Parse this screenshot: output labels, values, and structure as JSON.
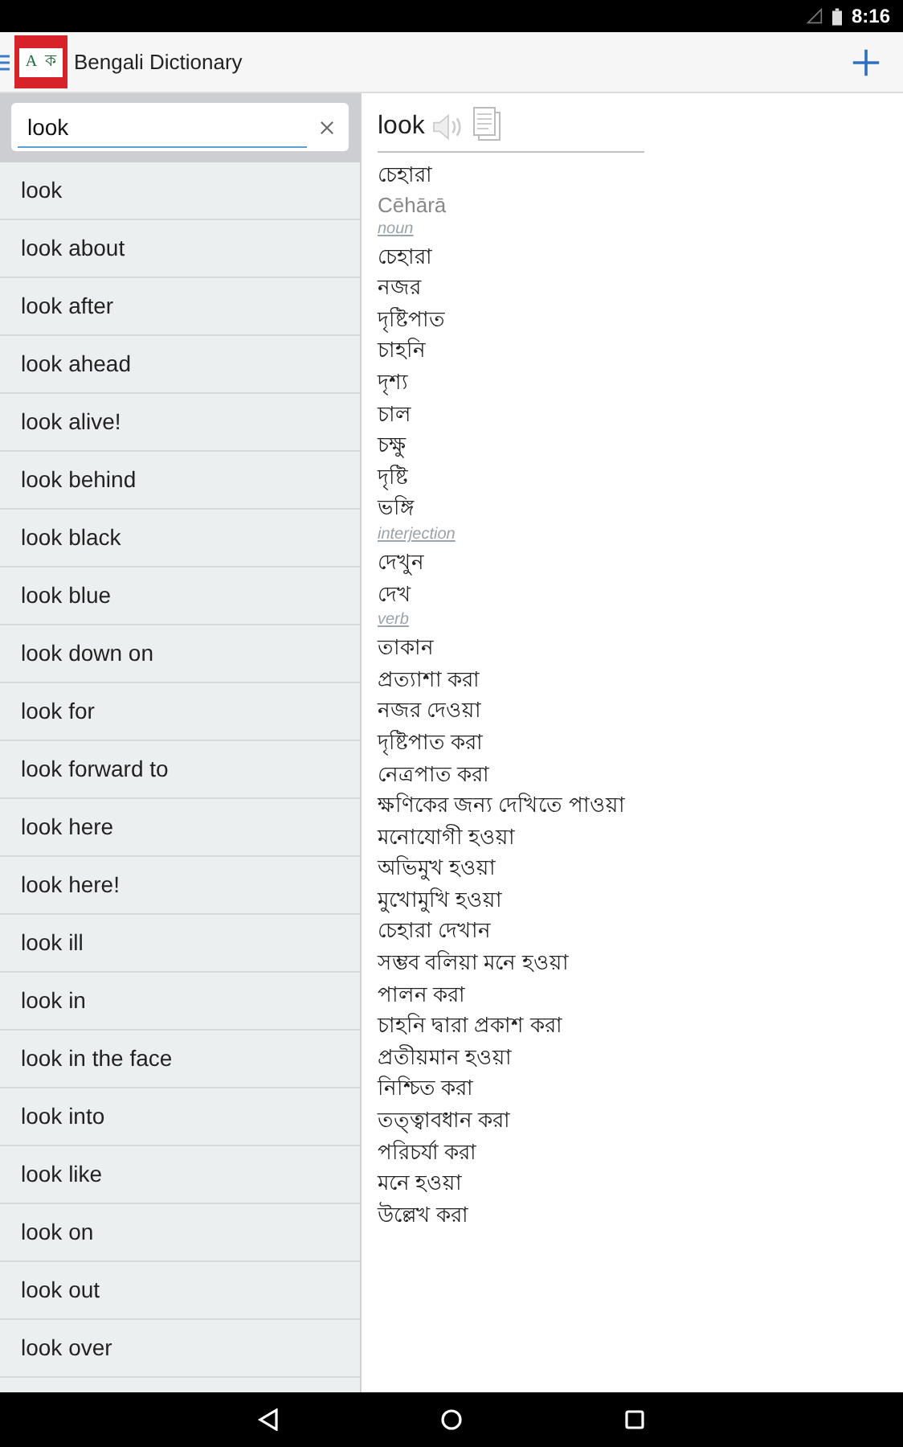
{
  "status_bar": {
    "time": "8:16"
  },
  "app_bar": {
    "title": "Bengali Dictionary",
    "logo_letters": [
      "A",
      "ক"
    ]
  },
  "search": {
    "value": "look"
  },
  "word_list": [
    "look",
    "look about",
    "look after",
    "look ahead",
    "look alive!",
    "look behind",
    "look black",
    "look blue",
    "look down on",
    "look for",
    "look forward to",
    "look here",
    "look here!",
    "look ill",
    "look in",
    "look in the face",
    "look into",
    "look like",
    "look on",
    "look out",
    "look over"
  ],
  "entry": {
    "headword": "look",
    "translation": "চেহারা",
    "transliteration": "Cēhārā",
    "senses": [
      {
        "pos": "noun",
        "meanings": [
          "চেহারা",
          "নজর",
          "দৃষ্টিপাত",
          "চাহনি",
          "দৃশ্য",
          "চাল",
          "চক্ষু",
          "দৃষ্টি",
          "ভঙ্গি"
        ]
      },
      {
        "pos": "interjection",
        "meanings": [
          "দেখুন",
          "দেখ"
        ]
      },
      {
        "pos": "verb",
        "meanings": [
          "তাকান",
          "প্রত্যাশা করা",
          "নজর দেওয়া",
          "দৃষ্টিপাত করা",
          "নেত্রপাত করা",
          "ক্ষণিকের জন্য দেখিতে পাওয়া",
          "মনোযোগী হওয়া",
          "অভিমুখ হওয়া",
          "মুখোমুখি হওয়া",
          "চেহারা দেখান",
          "সম্ভব বলিয়া মনে হওয়া",
          "পালন করা",
          "চাহনি দ্বারা প্রকাশ করা",
          "প্রতীয়মান হওয়া",
          "নিশ্চিত করা",
          "তত্ত্বাবধান করা",
          "পরিচর্যা করা",
          "মনে হওয়া",
          "উল্লেখ করা"
        ]
      }
    ]
  }
}
